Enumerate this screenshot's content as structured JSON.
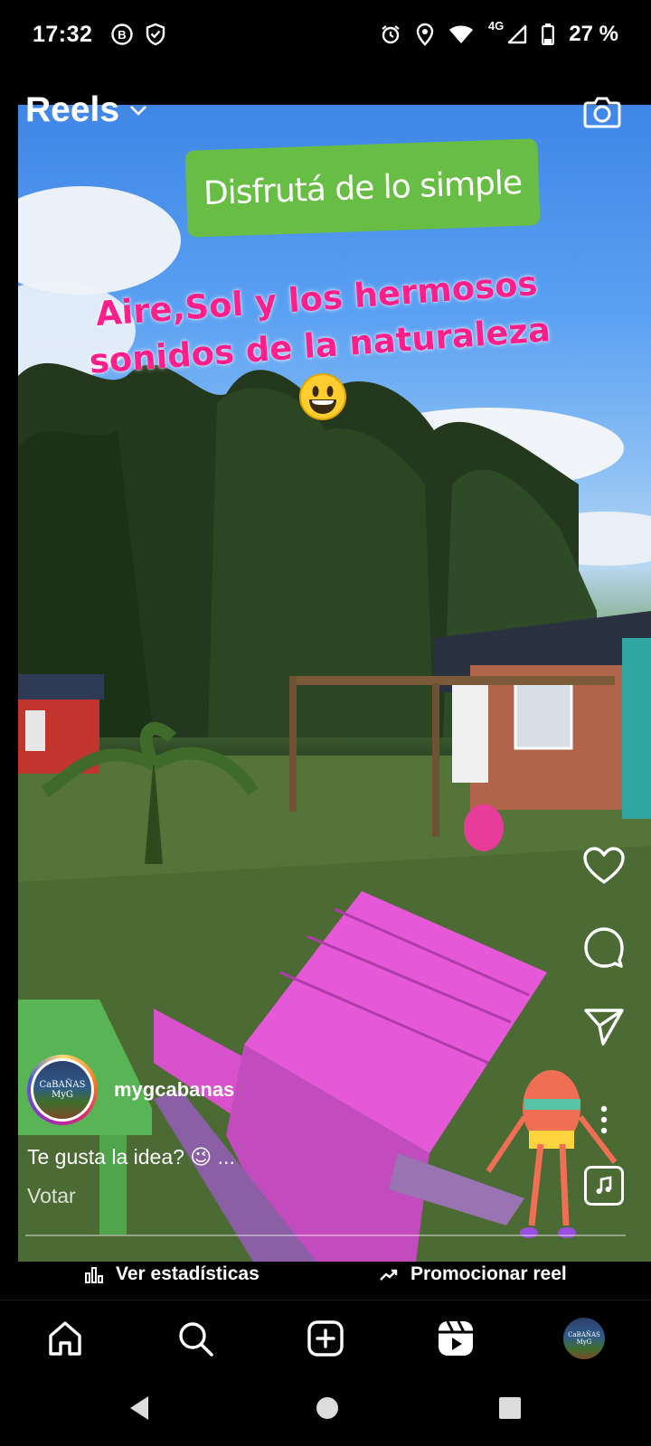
{
  "status_bar": {
    "time": "17:32",
    "left_icons": [
      "b-badge-icon",
      "shield-check-icon"
    ],
    "right_icons": [
      "alarm-icon",
      "location-icon",
      "wifi-icon",
      "signal-icon",
      "battery-icon"
    ],
    "network": "4G",
    "battery": "27 %"
  },
  "header": {
    "title": "Reels",
    "dropdown_icon": "chevron-down-icon",
    "camera_icon": "camera-icon"
  },
  "overlay": {
    "sticker_text": "Disfrutá de lo simple",
    "line1": "Aire,Sol y los hermosos",
    "line2": "sonidos de la naturaleza",
    "emoji": "smiley-emoji"
  },
  "actions": {
    "like": "heart-icon",
    "comment": "comment-icon",
    "share": "send-icon",
    "more": "more-vertical-icon",
    "audio": "music-note-icon"
  },
  "post": {
    "username": "mygcabanas",
    "avatar_text": "CaBAÑAS MyG",
    "caption": "Te gusta la idea? 😉 ...",
    "vote_label": "Votar"
  },
  "insights": {
    "stats_label": "Ver estadísticas",
    "promote_label": "Promocionar reel"
  },
  "bottom_nav": [
    "home-icon",
    "search-icon",
    "create-icon",
    "reels-icon",
    "profile-avatar"
  ],
  "system_nav": [
    "back-button",
    "home-button",
    "recents-button"
  ],
  "colors": {
    "sticker_green": "#68bd45",
    "overlay_pink": "#ff1f8a",
    "background": "#000000"
  }
}
